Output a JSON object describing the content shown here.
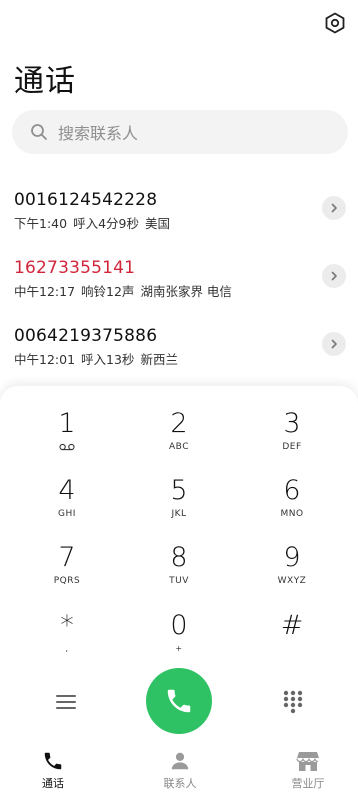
{
  "header": {
    "title": "通话",
    "settings_icon": "settings-hexagon-icon"
  },
  "search": {
    "placeholder": "搜索联系人",
    "icon": "search-icon"
  },
  "calls": [
    {
      "number": "0016124542228",
      "time": "下午1:40",
      "status": "呼入4分9秒",
      "location": "美国",
      "missed": false
    },
    {
      "number": "16273355141",
      "time": "中午12:17",
      "status": "响铃12声",
      "location": "湖南张家界 电信",
      "missed": true
    },
    {
      "number": "0064219375886",
      "time": "中午12:01",
      "status": "呼入13秒",
      "location": "新西兰",
      "missed": false
    }
  ],
  "dialpad": {
    "keys": [
      {
        "digit": "1",
        "letters": ""
      },
      {
        "digit": "2",
        "letters": "ABC"
      },
      {
        "digit": "3",
        "letters": "DEF"
      },
      {
        "digit": "4",
        "letters": "GHI"
      },
      {
        "digit": "5",
        "letters": "JKL"
      },
      {
        "digit": "6",
        "letters": "MNO"
      },
      {
        "digit": "7",
        "letters": "PQRS"
      },
      {
        "digit": "8",
        "letters": "TUV"
      },
      {
        "digit": "9",
        "letters": "WXYZ"
      },
      {
        "digit": "*",
        "letters": ","
      },
      {
        "digit": "0",
        "letters": "+"
      },
      {
        "digit": "#",
        "letters": ""
      }
    ]
  },
  "tabs": [
    {
      "label": "通话",
      "icon": "phone-icon",
      "active": true
    },
    {
      "label": "联系人",
      "icon": "person-icon",
      "active": false
    },
    {
      "label": "营业厅",
      "icon": "store-icon",
      "active": false
    }
  ],
  "colors": {
    "missed": "#d1263a",
    "call_button": "#2fc264",
    "search_bg": "#f3f3f3"
  }
}
